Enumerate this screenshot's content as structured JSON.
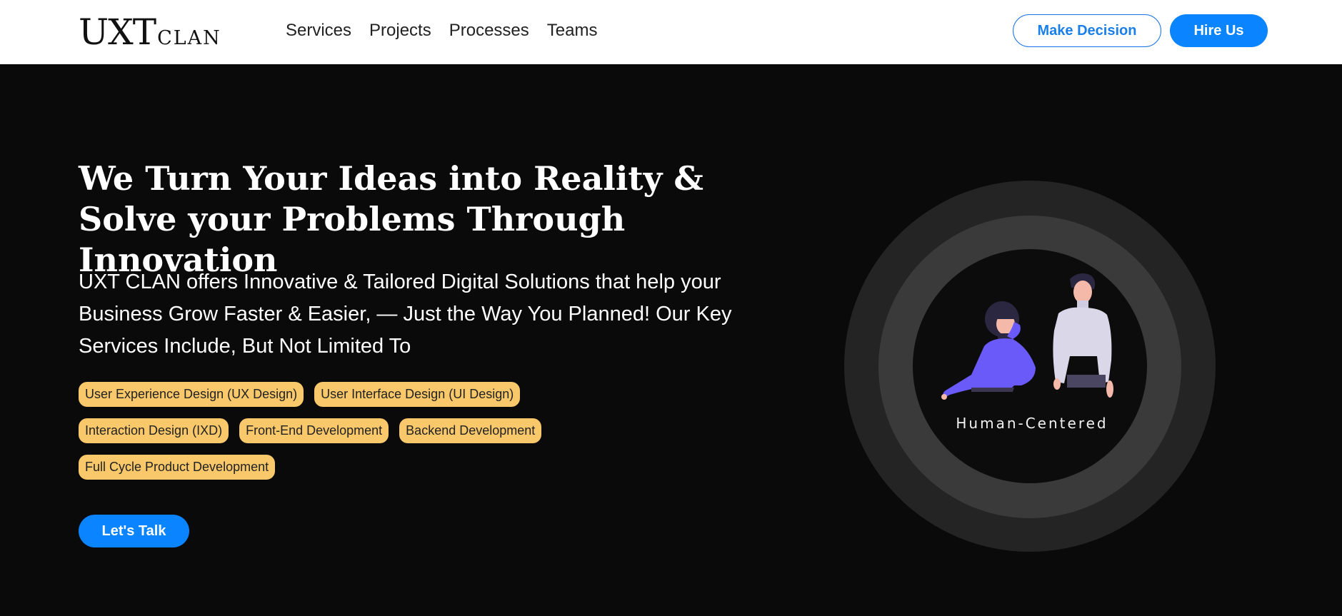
{
  "header": {
    "logo": {
      "main": "UXT",
      "sub": "CLAN"
    },
    "nav": [
      {
        "label": "Services"
      },
      {
        "label": "Projects"
      },
      {
        "label": "Processes"
      },
      {
        "label": "Teams"
      }
    ],
    "make_decision_label": "Make Decision",
    "hire_us_label": "Hire Us"
  },
  "hero": {
    "headline": "We Turn Your Ideas into Reality & Solve your Problems Through Innovation",
    "description": "UXT CLAN offers Innovative & Tailored Digital Solutions that help your Business Grow Faster & Easier, — Just the Way You Planned! Our Key Services Include, But Not Limited To",
    "services": [
      [
        "User Experience Design (UX Design)",
        "User Interface Design (UI Design)"
      ],
      [
        "Interaction Design (IXD)",
        "Front-End Development",
        "Backend Development"
      ],
      [
        "Full Cycle Product Development"
      ]
    ],
    "cta_label": "Let's Talk"
  },
  "illustration": {
    "label": "Human-Centered",
    "icon": "people-illustration"
  },
  "colors": {
    "accent": "#0a84ff",
    "tag_bg": "#f9c86a",
    "page_bg": "#0a0a0b",
    "figure_purple": "#6a5af9"
  }
}
